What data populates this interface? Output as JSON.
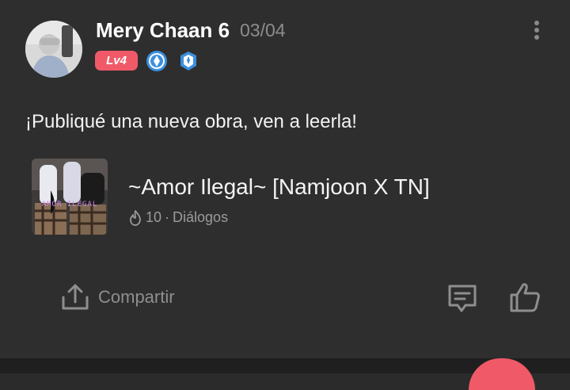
{
  "author": {
    "name": "Mery Chaan 6",
    "level": "Lv4"
  },
  "post": {
    "date": "03/04",
    "text": "¡Publiqué una nueva obra, ven a leerla!",
    "work": {
      "title": "~Amor Ilegal~ [Namjoon X TN]",
      "views": "10",
      "separator": "·",
      "category": "Diálogos",
      "cover_caption": "Amor Ilegal"
    }
  },
  "actions": {
    "share_label": "Compartir"
  },
  "icons": {
    "more": "more-vert-icon",
    "badge_1": "blue-drop-badge-icon",
    "badge_2": "blue-shield-badge-icon",
    "views": "flame-icon",
    "share": "share-upload-icon",
    "comment": "comment-icon",
    "like": "thumbs-up-icon"
  },
  "colors": {
    "accent": "#f05a68",
    "badge_blue": "#3b8fe0",
    "background": "#2e2e2e",
    "muted_text": "#8e8e8e"
  }
}
